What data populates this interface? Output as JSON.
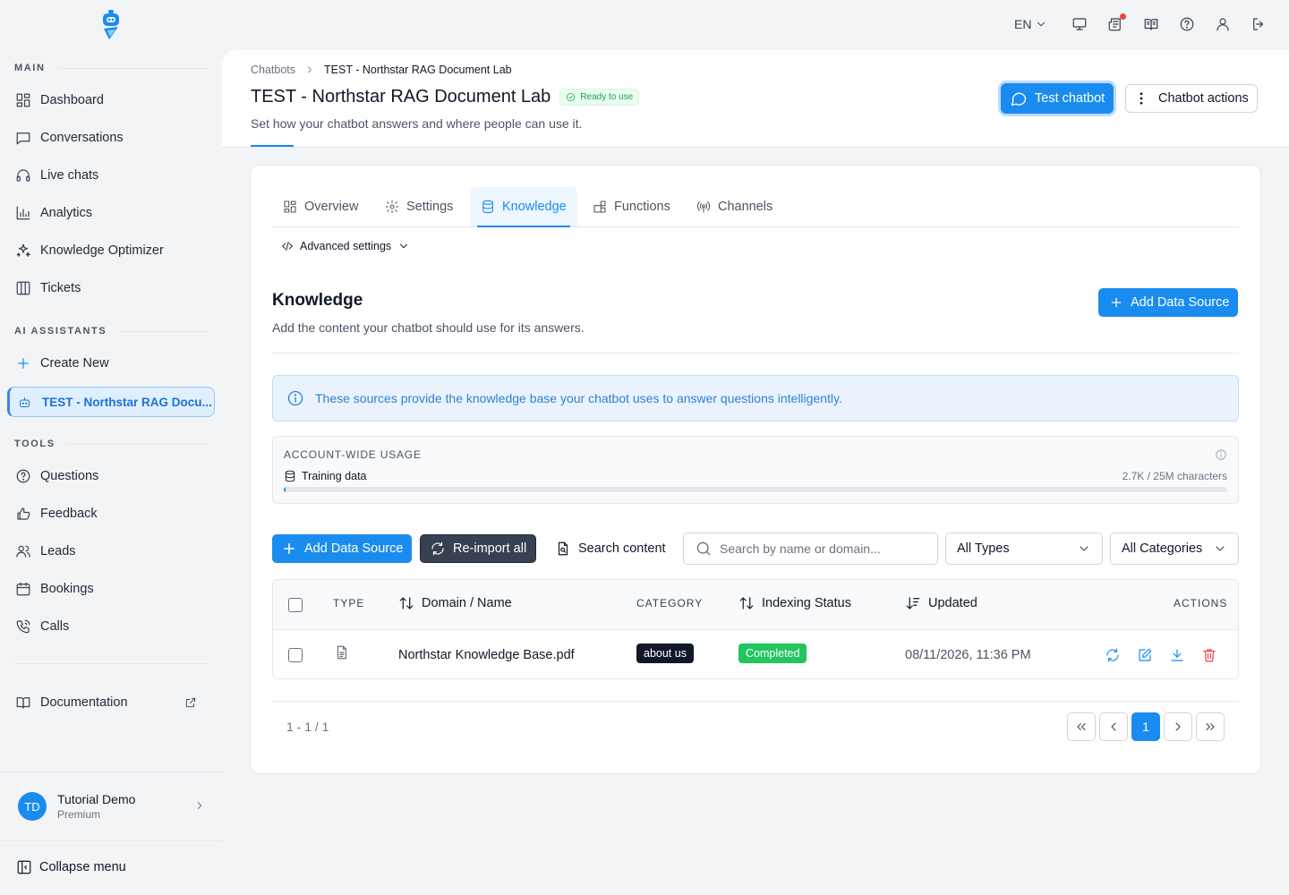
{
  "sidebar": {
    "sections": {
      "main": "MAIN",
      "ai": "AI ASSISTANTS",
      "tools": "TOOLS"
    },
    "main_items": [
      {
        "label": "Dashboard",
        "icon": "dashboard-icon"
      },
      {
        "label": "Conversations",
        "icon": "chat-icon"
      },
      {
        "label": "Live chats",
        "icon": "headset-icon"
      },
      {
        "label": "Analytics",
        "icon": "chart-icon"
      },
      {
        "label": "Knowledge Optimizer",
        "icon": "sparkles-icon"
      },
      {
        "label": "Tickets",
        "icon": "columns-icon"
      }
    ],
    "ai_items": [
      {
        "label": "Create New",
        "icon": "plus-icon"
      },
      {
        "label": "TEST - Northstar RAG Docu...",
        "icon": "bot-icon",
        "active": true
      }
    ],
    "tool_items": [
      {
        "label": "Questions",
        "icon": "help-circle-icon"
      },
      {
        "label": "Feedback",
        "icon": "thumbs-up-icon"
      },
      {
        "label": "Leads",
        "icon": "users-icon"
      },
      {
        "label": "Bookings",
        "icon": "calendar-icon"
      },
      {
        "label": "Calls",
        "icon": "phone-icon"
      }
    ],
    "documentation": "Documentation",
    "profile": {
      "initials": "TD",
      "name": "Tutorial Demo",
      "plan": "Premium"
    },
    "collapse": "Collapse menu"
  },
  "topbar": {
    "language": "EN",
    "icons": [
      "monitor-icon",
      "news-icon",
      "book-icon",
      "help-icon",
      "user-icon",
      "logout-icon"
    ]
  },
  "header": {
    "breadcrumb_root": "Chatbots",
    "breadcrumb_current": "TEST - Northstar RAG Document Lab",
    "title": "TEST - Northstar RAG Document Lab",
    "status": "Ready to use",
    "subtitle": "Set how your chatbot answers and where people can use it.",
    "test_button": "Test chatbot",
    "actions_button": "Chatbot actions"
  },
  "tabs": [
    {
      "label": "Overview",
      "icon": "grid-icon"
    },
    {
      "label": "Settings",
      "icon": "gear-icon"
    },
    {
      "label": "Knowledge",
      "icon": "database-icon",
      "active": true
    },
    {
      "label": "Functions",
      "icon": "blocks-icon"
    },
    {
      "label": "Channels",
      "icon": "broadcast-icon"
    }
  ],
  "advanced_settings": "Advanced settings",
  "knowledge": {
    "title": "Knowledge",
    "subtitle": "Add the content your chatbot should use for its answers.",
    "add_source": "Add Data Source",
    "info": "These sources provide the knowledge base your chatbot uses to answer questions intelligently."
  },
  "usage": {
    "title": "ACCOUNT-WIDE USAGE",
    "label": "Training data",
    "value": "2.7K / 25M characters",
    "fraction": 0.000108
  },
  "toolbar": {
    "add_source": "Add Data Source",
    "reimport": "Re-import all",
    "search_content": "Search content",
    "search_placeholder": "Search by name or domain...",
    "type_filter": "All Types",
    "category_filter": "All Categories"
  },
  "table": {
    "headers": {
      "type": "TYPE",
      "name": "Domain / Name",
      "category": "CATEGORY",
      "status": "Indexing Status",
      "updated": "Updated",
      "actions": "ACTIONS"
    },
    "rows": [
      {
        "type_icon": "file-text-icon",
        "name": "Northstar Knowledge Base.pdf",
        "category": "about us",
        "status": "Completed",
        "updated": "08/11/2026, 11:36 PM"
      }
    ]
  },
  "pagination": {
    "summary": "1 - 1 / 1",
    "current_page": "1"
  },
  "colors": {
    "primary": "#1a8cf0",
    "success": "#22c55e",
    "danger": "#ef4444",
    "dark": "#111827"
  }
}
